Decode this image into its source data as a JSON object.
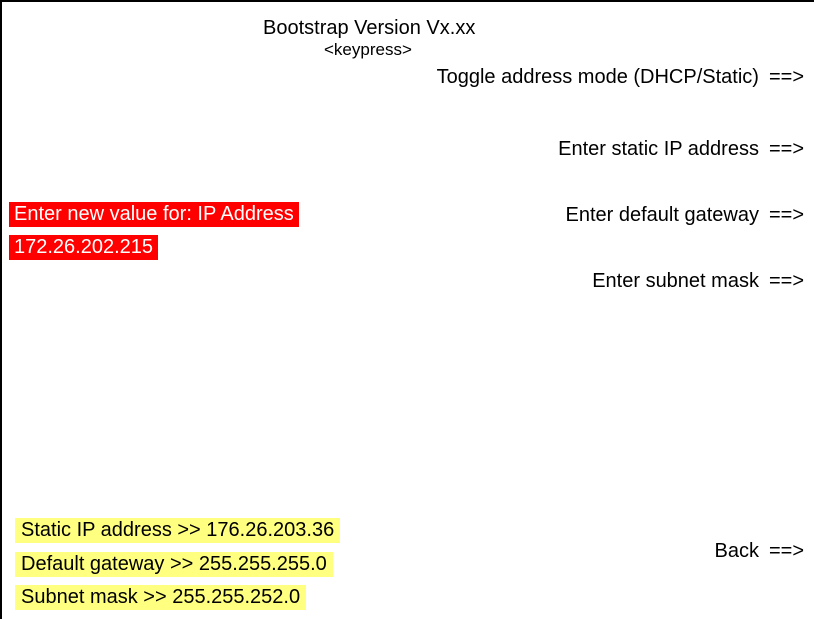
{
  "header": {
    "title": "Bootstrap Version Vx.xx",
    "subtitle": "<keypress>"
  },
  "softkeys": [
    {
      "label": "Toggle address mode (DHCP/Static)",
      "arrow": "==>"
    },
    {
      "label": "Enter static IP address",
      "arrow": "==>"
    },
    {
      "label": "Enter default gateway",
      "arrow": "==>"
    },
    {
      "label": "Enter subnet mask",
      "arrow": "==>"
    },
    {
      "label": "Back",
      "arrow": "==>"
    }
  ],
  "prompt": {
    "label": "Enter new value for: IP Address",
    "value": "172.26.202.215"
  },
  "status": [
    "Static IP address >> 176.26.203.36",
    "Default gateway >> 255.255.255.0",
    "Subnet mask >> 255.255.252.0"
  ],
  "colors": {
    "prompt_background": "#ff0000",
    "prompt_text": "#ffffff",
    "status_background": "#ffff80"
  }
}
